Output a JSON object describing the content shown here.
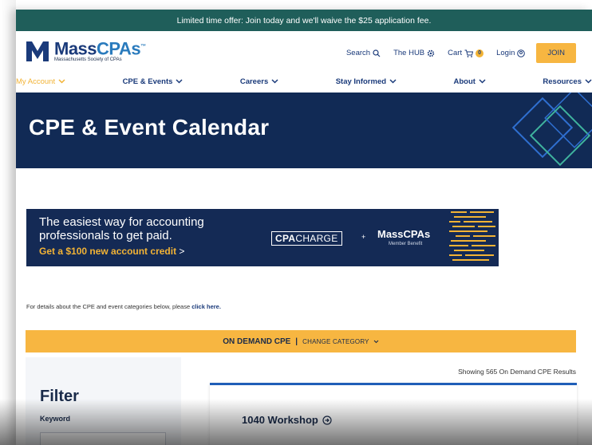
{
  "promo": {
    "text": "Limited time offer: Join today and we'll waive the $25 application fee."
  },
  "logo": {
    "name_part1": "Mass",
    "name_part2": "CPAs",
    "tm": "™",
    "subtitle": "Massachusetts Society of CPAs"
  },
  "utility": {
    "search_label": "Search",
    "hub_label": "The HUB",
    "cart_label": "Cart",
    "cart_count": "0",
    "login_label": "Login",
    "join_label": "JOIN"
  },
  "nav": {
    "items": [
      {
        "label": "My Account"
      },
      {
        "label": "CPE & Events"
      },
      {
        "label": "Careers"
      },
      {
        "label": "Stay Informed"
      },
      {
        "label": "About"
      },
      {
        "label": "Resources"
      }
    ]
  },
  "hero": {
    "title": "CPE & Event Calendar"
  },
  "banner": {
    "line1": "The easiest way for accounting",
    "line2": "professionals to get paid.",
    "cta": "Get a $100 new account credit",
    "cta_arrow": ">",
    "cpacharge_a": "CPA",
    "cpacharge_b": "CHARGE",
    "plus": "+",
    "masscpas": "MassCPAs",
    "benefit": "Member Benefit"
  },
  "details": {
    "text": "For details about the CPE and event categories below, please ",
    "link": "click here."
  },
  "category": {
    "current": "ON DEMAND CPE",
    "separator": "|",
    "change_label": "CHANGE CATEGORY"
  },
  "results": {
    "showing": "Showing 565 On Demand CPE Results"
  },
  "filter": {
    "title": "Filter",
    "keyword_label": "Keyword",
    "keyword_value": ""
  },
  "result_items": [
    {
      "title": "1040 Workshop"
    }
  ],
  "colors": {
    "promo": "#1f5e5a",
    "navy": "#112a55",
    "accent": "#f7b641",
    "link": "#1a3a7a"
  }
}
